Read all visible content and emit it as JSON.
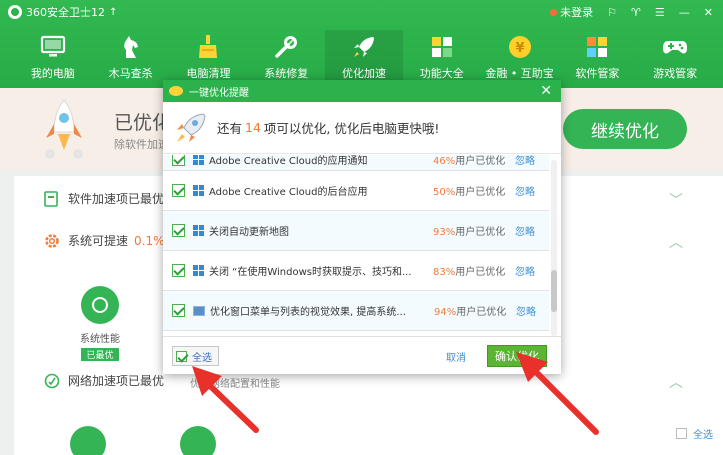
{
  "app": {
    "title": "360安全卫士12",
    "upgrade_icon": "arrow-up-icon",
    "login": "未登录",
    "controls": [
      "skin-icon",
      "shirt-icon",
      "menu-icon",
      "minimize-icon",
      "close-icon"
    ]
  },
  "nav": [
    {
      "label": "我的电脑",
      "icon": "monitor-icon"
    },
    {
      "label": "木马查杀",
      "icon": "horse-icon"
    },
    {
      "label": "电脑清理",
      "icon": "broom-icon"
    },
    {
      "label": "系统修复",
      "icon": "wrench-icon"
    },
    {
      "label": "优化加速",
      "icon": "rocket-icon",
      "active": true
    },
    {
      "label": "功能大全",
      "icon": "grid-icon"
    },
    {
      "label": "金融 • 互助宝",
      "icon": "coin-icon"
    },
    {
      "label": "软件管家",
      "icon": "apps-icon"
    },
    {
      "label": "游戏管家",
      "icon": "gamepad-icon"
    }
  ],
  "banner": {
    "title": "已优化",
    "subtitle": "除软件加速",
    "continue_button": "继续优化"
  },
  "main": {
    "row1": "软件加速项已最优",
    "row2_label": "系统可提速",
    "row2_pct": "0.1%",
    "perf_label": "系统性能",
    "perf_badge": "已最优",
    "row3": "网络加速项已最优",
    "row3_sub": "优化网络配置和性能",
    "select_all": "全选"
  },
  "dialog": {
    "title": "一键优化提醒",
    "msg_prefix": "还有",
    "msg_count": "14",
    "msg_suffix": "项可以优化, 优化后电脑更快哦!",
    "items": [
      {
        "name": "Adobe Creative Cloud的应用通知",
        "pct": "46%",
        "pct_suffix": "用户已优化",
        "ignore": "忽略",
        "icon": "windows-icon"
      },
      {
        "name": "Adobe Creative Cloud的后台应用",
        "pct": "50%",
        "pct_suffix": "用户已优化",
        "ignore": "忽略",
        "icon": "windows-icon"
      },
      {
        "name": "关闭自动更新地图",
        "pct": "93%",
        "pct_suffix": "用户已优化",
        "ignore": "忽略",
        "icon": "windows-icon"
      },
      {
        "name": "关闭 “在使用Windows时获取提示、技巧和...",
        "pct": "83%",
        "pct_suffix": "用户已优化",
        "ignore": "忽略",
        "icon": "windows-icon"
      },
      {
        "name": "优化窗口菜单与列表的视觉效果, 提高系统...",
        "pct": "94%",
        "pct_suffix": "用户已优化",
        "ignore": "忽略",
        "icon": "image-icon"
      }
    ],
    "select_all": "全选",
    "cancel": "取消",
    "confirm": "确认优化"
  },
  "colors": {
    "brand_green": "#2bb24c",
    "accent_orange": "#f07b3a",
    "link_blue": "#3b8fd9",
    "annotation_red": "#e8312b"
  }
}
